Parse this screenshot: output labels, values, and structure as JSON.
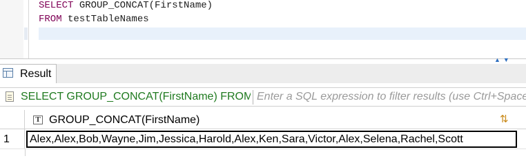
{
  "editor": {
    "line1": {
      "keyword": "SELECT",
      "rest": " GROUP_CONCAT(FirstName)"
    },
    "line2": {
      "keyword": "FROM",
      "rest": " testTableNames"
    }
  },
  "panel": {
    "nav_arrows": "▲▼"
  },
  "result_tab": {
    "label": "Result",
    "icon": "table-icon"
  },
  "filter": {
    "query_text": "SELECT GROUP_CONCAT(FirstName) FROM testTableNames",
    "placeholder": "Enter a SQL expression to filter results (use Ctrl+Space)",
    "icon": "sql-doc-icon"
  },
  "grid": {
    "columns": [
      {
        "type_icon": "T",
        "label": "GROUP_CONCAT(FirstName)"
      }
    ],
    "sort_icon": "⇅",
    "rows": [
      {
        "num": "1",
        "value": "Alex,Alex,Bob,Wayne,Jim,Jessica,Harold,Alex,Ken,Sara,Victor,Alex,Selena,Rachel,Scott"
      }
    ]
  },
  "colors": {
    "keyword": "#7f0055",
    "filter_query": "#1f7a1f",
    "current_line": "#e8f1fb",
    "accent": "#2c6dbf"
  }
}
